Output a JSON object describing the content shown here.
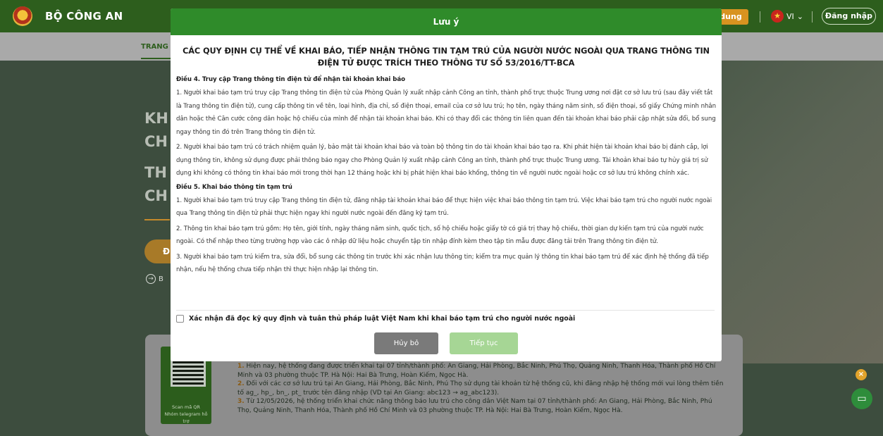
{
  "header": {
    "brand": "BỘ CÔNG AN",
    "guide_button": "dung",
    "language": "VI",
    "login_button": "Đăng nhập"
  },
  "subnav": {
    "active_tab": "TRANG"
  },
  "hero": {
    "title_lines": [
      "KH",
      "CH",
      "TH",
      "CH"
    ],
    "cta_label": "Đ",
    "link_label": "B"
  },
  "notice": {
    "qr_caption": [
      "Scan mã QR",
      "Nhóm telegram hỗ trợ"
    ],
    "items": [
      {
        "num": "1.",
        "text": " Hiện nay, hệ thống đang được triển khai tại 07 tỉnh/thành phố: An Giang, Hải Phòng, Bắc Ninh, Phú Thọ, Quảng Ninh, Thanh Hóa, Thành phố Hồ Chí Minh và 03 phường thuộc TP. Hà Nội: Hai Bà Trưng, Hoàn Kiếm, Ngọc Hà."
      },
      {
        "num": "2.",
        "text": " Đối với các cơ sở lưu trú tại An Giang, Hải Phòng, Bắc Ninh, Phú Thọ sử dụng tài khoản từ hệ thống cũ, khi đăng nhập hệ thống mới vui lòng thêm tiền tố ag_, hp_, bn_, pt_ trước tên đăng nhập (VD tại An Giang: abc123 → ag_abc123)."
      },
      {
        "num": "3.",
        "text": " Từ 12/05/2026, hệ thống triển khai chức năng thông báo lưu trú cho công dân Việt Nam tại 07 tỉnh/thành phố: An Giang, Hải Phòng, Bắc Ninh, Phú Thọ, Quảng Ninh, Thanh Hóa, Thành phố Hồ Chí Minh và 03 phường thuộc TP. Hà Nội: Hai Bà Trưng, Hoàn Kiếm, Ngọc Hà."
      }
    ]
  },
  "modal": {
    "title": "Lưu ý",
    "heading": "CÁC QUY ĐỊNH CỤ THỂ VỀ KHAI BÁO, TIẾP NHẬN THÔNG TIN TẠM TRÚ CỦA NGƯỜI NƯỚC NGOÀI QUA TRANG THÔNG TIN ĐIỆN TỬ ĐƯỢC TRÍCH THEO THÔNG TƯ SỐ 53/2016/TT-BCA",
    "article4_title": "Điều 4. Truy cập Trang thông tin điện tử để nhận tài khoản khai báo",
    "article4_p1": "1. Người khai báo tạm trú truy cập Trang thông tin điện tử của Phòng Quản lý xuất nhập cảnh Công an tỉnh, thành phố trực thuộc Trung ương nơi đặt cơ sở lưu trú (sau đây viết tắt là Trang thông tin điện tử), cung cấp thông tin về tên, loại hình, địa chỉ, số điện thoại, email của cơ sở lưu trú; họ tên, ngày tháng năm sinh, số điện thoại, số giấy Chứng minh nhân dân hoặc thẻ Căn cước công dân hoặc hộ chiếu của mình để nhận tài khoản khai báo. Khi có thay đổi các thông tin liên quan đến tài khoản khai báo phải cập nhật sửa đổi, bổ sung ngay thông tin đó trên Trang thông tin điện tử.",
    "article4_p2": "2. Người khai báo tạm trú có trách nhiệm quản lý, bảo mật tài khoản khai báo và toàn bộ thông tin do tài khoản khai báo tạo ra. Khi phát hiện tài khoản khai báo bị đánh cắp, lợi dụng thông tin, không sử dụng được phải thông báo ngay cho Phòng Quản lý xuất nhập cảnh Công an tỉnh, thành phố trực thuộc Trung ương. Tài khoản khai báo tự hủy giá trị sử dụng khi không có thông tin khai báo mới trong thời hạn 12 tháng hoặc khi bị phát hiện khai báo khống, thông tin về người nước ngoài hoặc cơ sở lưu trú không chính xác.",
    "article5_title": "Điều 5. Khai báo thông tin tạm trú",
    "article5_p1": "1. Người khai báo tạm trú truy cập Trang thông tin điện tử, đăng nhập tài khoản khai báo để thực hiện việc khai báo thông tin tạm trú. Việc khai báo tạm trú cho người nước ngoài qua Trang thông tin điện tử phải thực hiện ngay khi người nước ngoài đến đăng ký tạm trú.",
    "article5_p2": "2. Thông tin khai báo tạm trú gồm: Họ tên, giới tính, ngày tháng năm sinh, quốc tịch, số hộ chiếu hoặc giấy tờ có giá trị thay hộ chiếu, thời gian dự kiến tạm trú của người nước ngoài. Có thể nhập theo từng trường hợp vào các ô nhập dữ liệu hoặc chuyển tập tin nhập đính kèm theo tập tin mẫu được đăng tải trên Trang thông tin điện tử.",
    "article5_p3": "3. Người khai báo tạm trú kiểm tra, sửa đổi, bổ sung các thông tin trước khi xác nhận lưu thông tin; kiểm tra mục quản lý thông tin khai báo tạm trú để xác định hệ thống đã tiếp nhận, nếu hệ thống chưa tiếp nhận thì thực hiện nhập lại thông tin.",
    "confirm_label": "Xác nhận đã đọc kỹ quy định và tuân thủ pháp luật Việt Nam khi khai báo tạm trú cho người nước ngoài",
    "cancel_button": "Hủy bỏ",
    "continue_button": "Tiếp tục"
  },
  "colors": {
    "header_green": "#2f8b2a",
    "continue_disabled": "#a6d695",
    "cancel_gray": "#7a7a7a",
    "accent_orange": "#d89320"
  },
  "icons": [
    "police-emblem-icon",
    "vietnam-flag-icon",
    "chevron-down-icon",
    "circle-arrow-icon",
    "close-icon",
    "chat-icon"
  ]
}
